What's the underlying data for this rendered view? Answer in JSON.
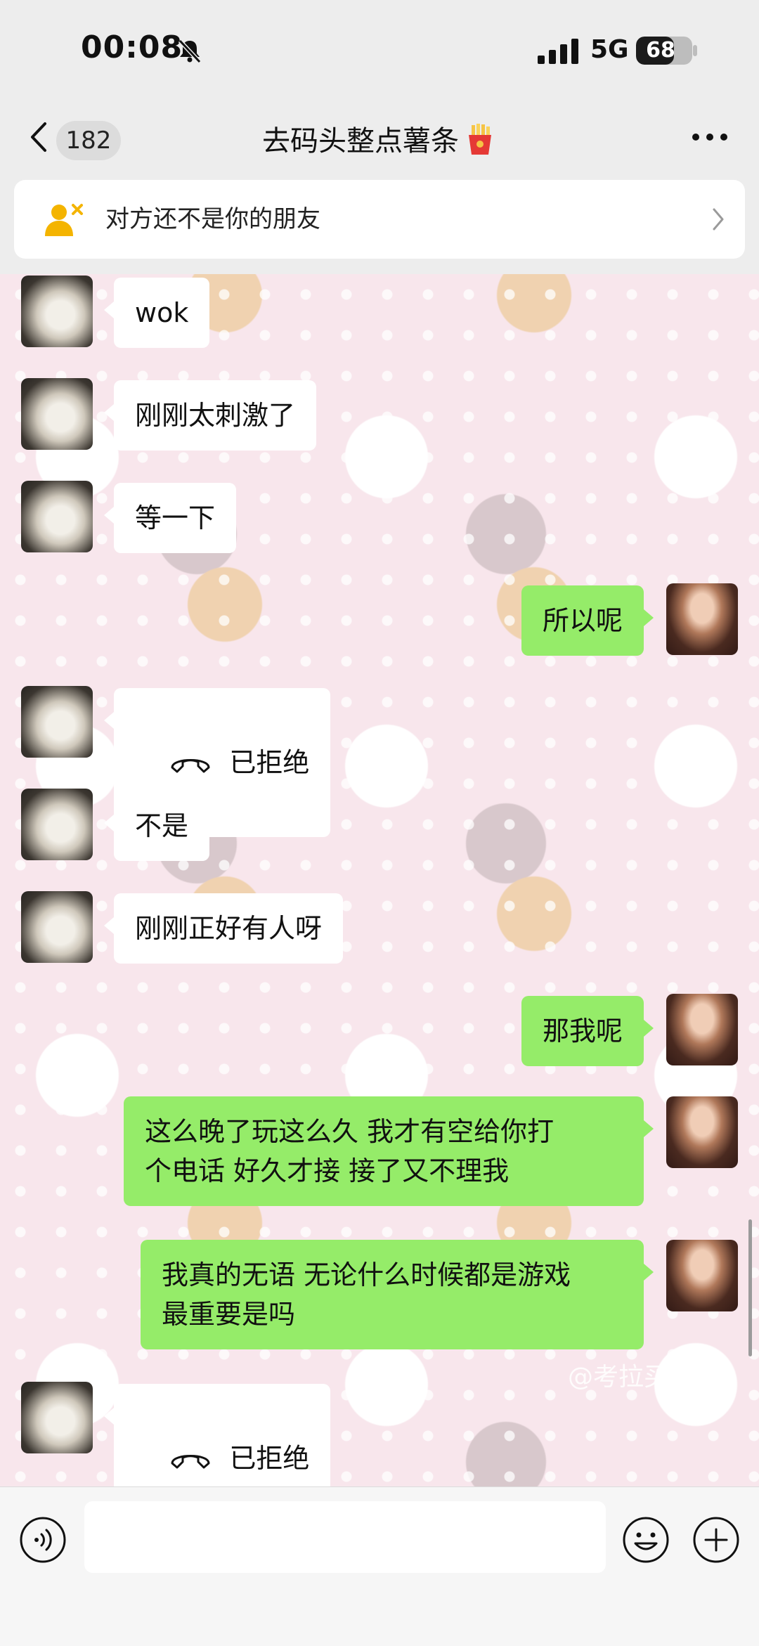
{
  "status_bar": {
    "time": "00:08",
    "network": "5G",
    "battery": "68",
    "battery_level": 0.68
  },
  "header": {
    "unread_count": "182",
    "title": "去码头整点薯条"
  },
  "banner": {
    "text": "对方还不是你的朋友"
  },
  "messages": [
    {
      "from": "them",
      "text": "wok"
    },
    {
      "from": "them",
      "text": "刚刚太刺激了"
    },
    {
      "from": "them",
      "text": "等一下"
    },
    {
      "from": "me",
      "text": "所以呢"
    },
    {
      "from": "them",
      "type": "call",
      "text": "已拒绝"
    },
    {
      "from": "them",
      "text": "不是"
    },
    {
      "from": "them",
      "text": "刚刚正好有人呀"
    },
    {
      "from": "me",
      "text": "那我呢"
    },
    {
      "from": "me",
      "text": "这么晚了玩这么久 我才有空给你打\n个电话 好久才接 接了又不理我"
    },
    {
      "from": "me",
      "text": "我真的无语 无论什么时候都是游戏\n最重要是吗"
    },
    {
      "from": "them",
      "type": "call",
      "text": "已拒绝"
    }
  ],
  "watermark": "@考拉买土豆",
  "input": {
    "value": "",
    "placeholder": ""
  },
  "icons": {
    "bell": "bell-slash-icon",
    "back": "chevron-left-icon",
    "title_emoji": "fries-icon",
    "more": "more-dots-icon",
    "banner": "add-friend-icon",
    "call": "phone-hangup-icon",
    "voice": "voice-icon",
    "emoji": "emoji-icon",
    "plus": "plus-icon"
  },
  "colors": {
    "my_bubble": "#95ec69",
    "their_bubble": "#ffffff",
    "banner_icon": "#f4b400"
  }
}
